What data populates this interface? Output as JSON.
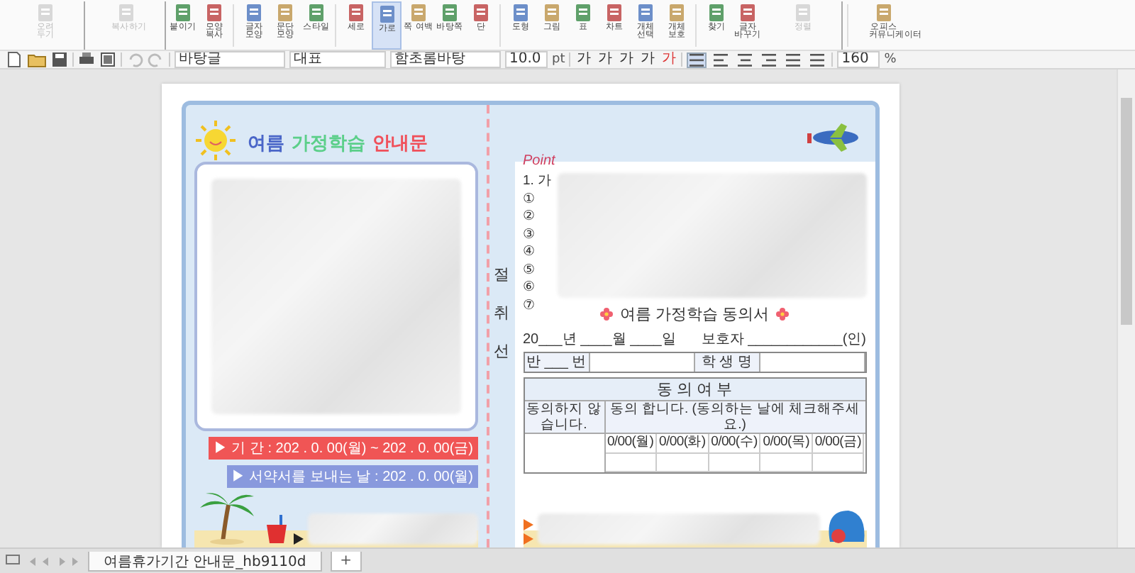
{
  "toolbar": {
    "items": [
      {
        "label": "오려 두기",
        "disabled": true,
        "selected": false
      },
      {
        "label": "복사하기",
        "disabled": true,
        "selected": false
      },
      {
        "label": "붙이기",
        "disabled": false,
        "selected": false
      },
      {
        "label": "모양 복사",
        "disabled": false,
        "selected": false
      },
      {
        "label": "글자 모양",
        "disabled": false,
        "selected": false
      },
      {
        "label": "문단 모양",
        "disabled": false,
        "selected": false
      },
      {
        "label": "스타일",
        "disabled": false,
        "selected": false
      },
      {
        "label": "세로",
        "disabled": false,
        "selected": false
      },
      {
        "label": "가로",
        "disabled": false,
        "selected": true
      },
      {
        "label": "쪽 여백",
        "disabled": false,
        "selected": false
      },
      {
        "label": "바탕쪽",
        "disabled": false,
        "selected": false
      },
      {
        "label": "단",
        "disabled": false,
        "selected": false
      },
      {
        "label": "도형",
        "disabled": false,
        "selected": false
      },
      {
        "label": "그림",
        "disabled": false,
        "selected": false
      },
      {
        "label": "표",
        "disabled": false,
        "selected": false
      },
      {
        "label": "차트",
        "disabled": false,
        "selected": false
      },
      {
        "label": "개체 선택",
        "disabled": false,
        "selected": false
      },
      {
        "label": "개체 보호",
        "disabled": false,
        "selected": false
      },
      {
        "label": "찾기",
        "disabled": false,
        "selected": false
      },
      {
        "label": "글자 바꾸기",
        "disabled": false,
        "selected": false
      },
      {
        "label": "정렬",
        "disabled": true,
        "selected": false
      },
      {
        "label": "오피스 커뮤니케이터",
        "disabled": false,
        "selected": false
      }
    ]
  },
  "format_bar": {
    "style": "바탕글",
    "language": "대표",
    "font": "함초롬바탕",
    "size": "10.0",
    "size_unit": "pt",
    "char_buttons": [
      "가",
      "가",
      "가",
      "가",
      "가"
    ],
    "align_buttons": [
      {
        "selected": true
      },
      {
        "selected": false
      },
      {
        "selected": false
      },
      {
        "selected": false
      },
      {
        "selected": false
      },
      {
        "selected": false
      }
    ],
    "zoom": "160",
    "zoom_unit": "%"
  },
  "document": {
    "notice_title": [
      {
        "text": "여름",
        "color": "#4a66c8"
      },
      {
        "text": "가정학습",
        "color": "#5ccf8a"
      },
      {
        "text": "안내문",
        "color": "#f0505a"
      }
    ],
    "period": "▶ 기   간 : 202 . 0. 00(월) ~ 202 . 0. 00(금)",
    "submit_date": "▶ 서약서를 보내는 날 : 202 . 0. 00(월)",
    "cut_line": [
      "절",
      "취",
      "선"
    ],
    "point_label": "Point",
    "question_heading": "1. 가",
    "numbers": [
      "①",
      "②",
      "③",
      "④",
      "⑤",
      "⑥",
      "⑦"
    ],
    "consent_title": "여름 가정학습 동의서",
    "date_line": "20___년 ____월 ____일",
    "guardian": "보호자 ____________(인)",
    "class_label": "반 ___ 번",
    "name_label": "학 생 명",
    "agree_title": "동 의 여 부",
    "disagree_label": "동의하지 않습니다.",
    "agree_label": "동의 합니다. (동의하는 날에 체크해주세요.)",
    "days": [
      "0/00(월)",
      "0/00(화)",
      "0/00(수)",
      "0/00(목)",
      "0/00(금)"
    ]
  },
  "tabs": [
    {
      "label": "여름휴가기간 안내문_hb9110d",
      "selected": true
    }
  ],
  "add_tab": "+"
}
